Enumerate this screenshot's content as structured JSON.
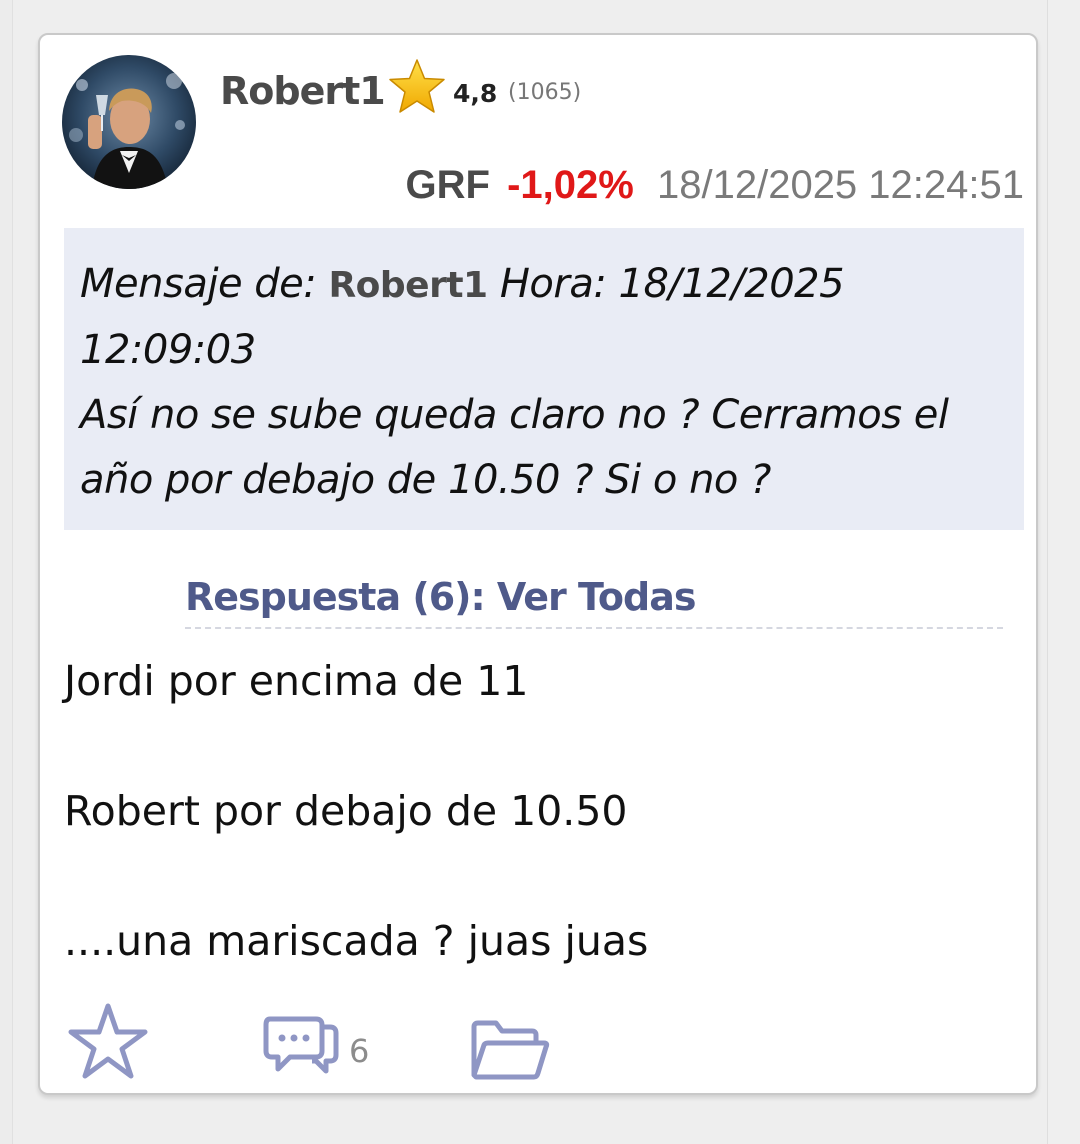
{
  "post": {
    "username": "Robert1",
    "rating": "4,8",
    "rating_count": "(1065)",
    "ticker": "GRF",
    "change": "-1,02%",
    "timestamp": "18/12/2025 12:24:51",
    "quote": {
      "prefix": "Mensaje de: ",
      "author": "Robert1",
      "time_label": " Hora: 18/12/2025 12:09:03",
      "text": "Así no se sube queda claro no ? Cerramos el año por debajo de 10.50 ?  Si o no ?"
    },
    "replies_link": "Respuesta (6): Ver Todas",
    "body_lines": [
      "Jordi por encima de 11",
      "Robert por debajo de 10.50",
      "....una mariscada ? juas juas"
    ],
    "actions": {
      "favorite_icon": "star-outline-icon",
      "comments_icon": "speech-bubbles-icon",
      "comments_count": "6",
      "folder_icon": "folder-open-icon"
    }
  },
  "colors": {
    "change_negative": "#e01818",
    "quote_background": "#e9ecf5",
    "link": "#4f5a8a",
    "icon": "#8f96c4"
  }
}
